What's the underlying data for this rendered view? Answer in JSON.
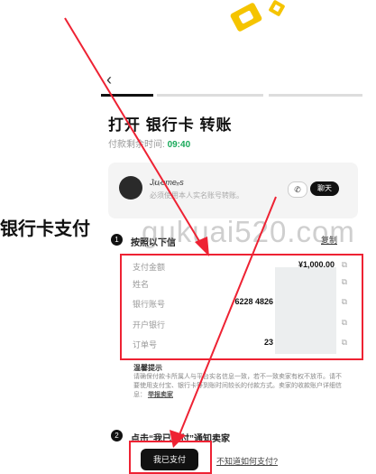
{
  "page": {
    "back_glyph": "‹",
    "title": "打开 银行卡 转账",
    "timer_label": "付款剩余时间:",
    "timer_value": "09:40",
    "seller": {
      "name": "Jᵢuᵣomeᵣᵣs",
      "note": "必须使用本人实名账号转账。",
      "phone_icon": "phone-icon",
      "chat_label": "聊天"
    },
    "side_label": "银行卡支付",
    "watermark": "gukuai520.com",
    "step1": {
      "number": "1",
      "title": "按照以下信",
      "copy_all": "复制"
    },
    "details": [
      {
        "label": "支付金额",
        "value": "¥1,000.00"
      },
      {
        "label": "姓名",
        "value": ""
      },
      {
        "label": "银行账号",
        "value": "6228 4826"
      },
      {
        "label": "开户银行",
        "value": ""
      },
      {
        "label": "订单号",
        "value": "23"
      }
    ],
    "tips": {
      "title": "温馨提示",
      "body": "请确保付款卡所属人与平台实名信息一致，若不一致卖家有权不放币。请不要使用支付宝、银行卡等到账时间较长的付款方式。卖家的收款账户详细信息：",
      "link": "举报卖家"
    },
    "step2": {
      "number": "2",
      "title": "点击“我已支付”通知卖家"
    },
    "pay_button": "我已支付",
    "help_link": "不知道如何支付?"
  },
  "colors": {
    "accent_red": "#ee2233",
    "timer_green": "#19a95a",
    "logo_yellow": "#f5c400"
  }
}
